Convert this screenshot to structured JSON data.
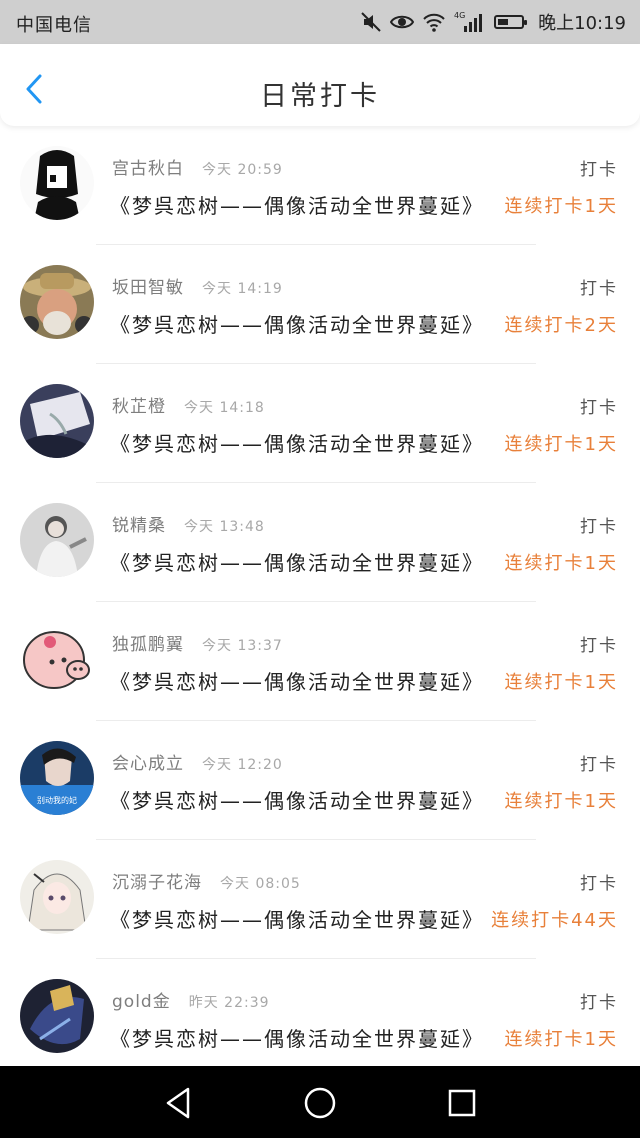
{
  "status_bar": {
    "carrier": "中国电信",
    "time": "晚上10:19",
    "icons": [
      "mute-icon",
      "eye-icon",
      "wifi-icon",
      "signal-4g-icon",
      "battery-icon"
    ],
    "network_label": "4G"
  },
  "header": {
    "title": "日常打卡",
    "back_icon": "chevron-left-icon",
    "accent_color": "#2196f3"
  },
  "entries": [
    {
      "name": "宫古秋白",
      "time": "今天 20:59",
      "activity": "《梦呉恋树——偶像活动全世界蔓延》",
      "checkin_label": "打卡",
      "streak": "连续打卡1天"
    },
    {
      "name": "坂田智敏",
      "time": "今天 14:19",
      "activity": "《梦呉恋树——偶像活动全世界蔓延》",
      "checkin_label": "打卡",
      "streak": "连续打卡2天"
    },
    {
      "name": "秋芷橙",
      "time": "今天 14:18",
      "activity": "《梦呉恋树——偶像活动全世界蔓延》",
      "checkin_label": "打卡",
      "streak": "连续打卡1天"
    },
    {
      "name": "锐精桑",
      "time": "今天 13:48",
      "activity": "《梦呉恋树——偶像活动全世界蔓延》",
      "checkin_label": "打卡",
      "streak": "连续打卡1天"
    },
    {
      "name": "独孤鹏翼",
      "time": "今天 13:37",
      "activity": "《梦呉恋树——偶像活动全世界蔓延》",
      "checkin_label": "打卡",
      "streak": "连续打卡1天"
    },
    {
      "name": "会心成立",
      "time": "今天 12:20",
      "activity": "《梦呉恋树——偶像活动全世界蔓延》",
      "checkin_label": "打卡",
      "streak": "连续打卡1天",
      "avatar_caption": "别动我的妃"
    },
    {
      "name": "沉溺子花海",
      "time": "今天 08:05",
      "activity": "《梦呉恋树——偶像活动全世界蔓延》",
      "checkin_label": "打卡",
      "streak": "连续打卡44天"
    },
    {
      "name": "gold金",
      "time": "昨天 22:39",
      "activity": "《梦呉恋树——偶像活动全世界蔓延》",
      "checkin_label": "打卡",
      "streak": "连续打卡1天"
    }
  ],
  "colors": {
    "streak": "#e8803a",
    "status_bar_bg": "#cfcfcf",
    "nav_bar_bg": "#000000"
  },
  "nav_bar": {
    "icons": [
      "back-triangle-icon",
      "home-circle-icon",
      "recents-square-icon"
    ]
  }
}
